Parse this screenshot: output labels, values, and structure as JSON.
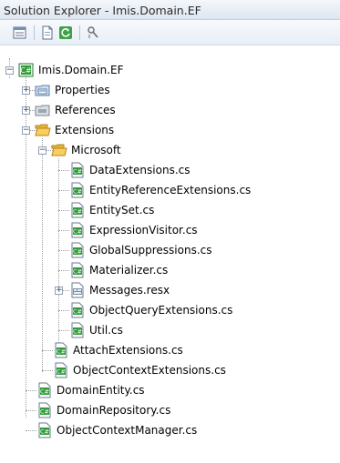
{
  "window": {
    "title": "Solution Explorer - Imis.Domain.EF"
  },
  "toolbar": {
    "buttons": [
      {
        "name": "properties-icon"
      },
      {
        "name": "show-all-files-icon"
      },
      {
        "name": "refresh-icon"
      },
      {
        "name": "view-class-diagram-icon"
      }
    ]
  },
  "tree": {
    "project": {
      "label": "Imis.Domain.EF",
      "icon": "csharp-project-icon"
    },
    "properties": {
      "label": "Properties",
      "icon": "properties-folder-icon"
    },
    "references": {
      "label": "References",
      "icon": "references-folder-icon"
    },
    "extensions": {
      "label": "Extensions",
      "icon": "open-folder-icon"
    },
    "microsoft": {
      "label": "Microsoft",
      "icon": "open-folder-icon"
    },
    "microsoft_files": [
      {
        "label": "DataExtensions.cs",
        "icon": "cs-file-icon"
      },
      {
        "label": "EntityReferenceExtensions.cs",
        "icon": "cs-file-icon"
      },
      {
        "label": "EntitySet.cs",
        "icon": "cs-file-icon"
      },
      {
        "label": "ExpressionVisitor.cs",
        "icon": "cs-file-icon"
      },
      {
        "label": "GlobalSuppressions.cs",
        "icon": "cs-file-icon"
      },
      {
        "label": "Materializer.cs",
        "icon": "cs-file-icon"
      },
      {
        "label": "Messages.resx",
        "icon": "resx-file-icon"
      },
      {
        "label": "ObjectQueryExtensions.cs",
        "icon": "cs-file-icon"
      },
      {
        "label": "Util.cs",
        "icon": "cs-file-icon"
      }
    ],
    "extensions_files": [
      {
        "label": "AttachExtensions.cs",
        "icon": "cs-file-icon"
      },
      {
        "label": "ObjectContextExtensions.cs",
        "icon": "cs-file-icon"
      }
    ],
    "project_files": [
      {
        "label": "DomainEntity.cs",
        "icon": "cs-file-icon"
      },
      {
        "label": "DomainRepository.cs",
        "icon": "cs-file-icon"
      },
      {
        "label": "ObjectContextManager.cs",
        "icon": "cs-file-icon"
      }
    ]
  },
  "colors": {
    "cs_icon": "#1f9b2a",
    "folder": "#f2c24e",
    "tree_line": "#a0a0a0"
  }
}
